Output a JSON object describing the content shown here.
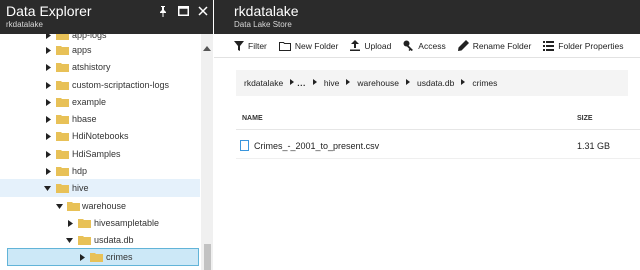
{
  "explorer": {
    "title": "Data Explorer",
    "account": "rkdatalake"
  },
  "tree": [
    {
      "label": "app-logs",
      "expanded": false
    },
    {
      "label": "apps",
      "expanded": false
    },
    {
      "label": "atshistory",
      "expanded": false
    },
    {
      "label": "custom-scriptaction-logs",
      "expanded": false
    },
    {
      "label": "example",
      "expanded": false
    },
    {
      "label": "hbase",
      "expanded": false
    },
    {
      "label": "HdiNotebooks",
      "expanded": false
    },
    {
      "label": "HdiSamples",
      "expanded": false
    },
    {
      "label": "hdp",
      "expanded": false
    },
    {
      "label": "hive",
      "expanded": true
    },
    {
      "label": "warehouse",
      "expanded": true
    },
    {
      "label": "hivesampletable",
      "expanded": false
    },
    {
      "label": "usdata.db",
      "expanded": true
    },
    {
      "label": "crimes",
      "expanded": false,
      "selected": true
    }
  ],
  "store": {
    "name": "rkdatalake",
    "type": "Data Lake Store"
  },
  "toolbar": {
    "filter": "Filter",
    "new_folder": "New Folder",
    "upload": "Upload",
    "access": "Access",
    "rename_folder": "Rename Folder",
    "folder_properties": "Folder Properties"
  },
  "breadcrumb": {
    "root": "rkdatalake",
    "ellipsis": "...",
    "items": [
      "hive",
      "warehouse",
      "usdata.db",
      "crimes"
    ]
  },
  "table": {
    "columns": [
      "NAME",
      "SIZE"
    ],
    "rows": [
      {
        "name": "Crimes_-_2001_to_present.csv",
        "size": "1.31 GB"
      }
    ]
  },
  "colors": {
    "header_bg": "#2b2b2b",
    "folder": "#e8c157",
    "selection": "#cce8f7",
    "selection_border": "#62b4d8",
    "file_icon": "#3a96dd"
  }
}
